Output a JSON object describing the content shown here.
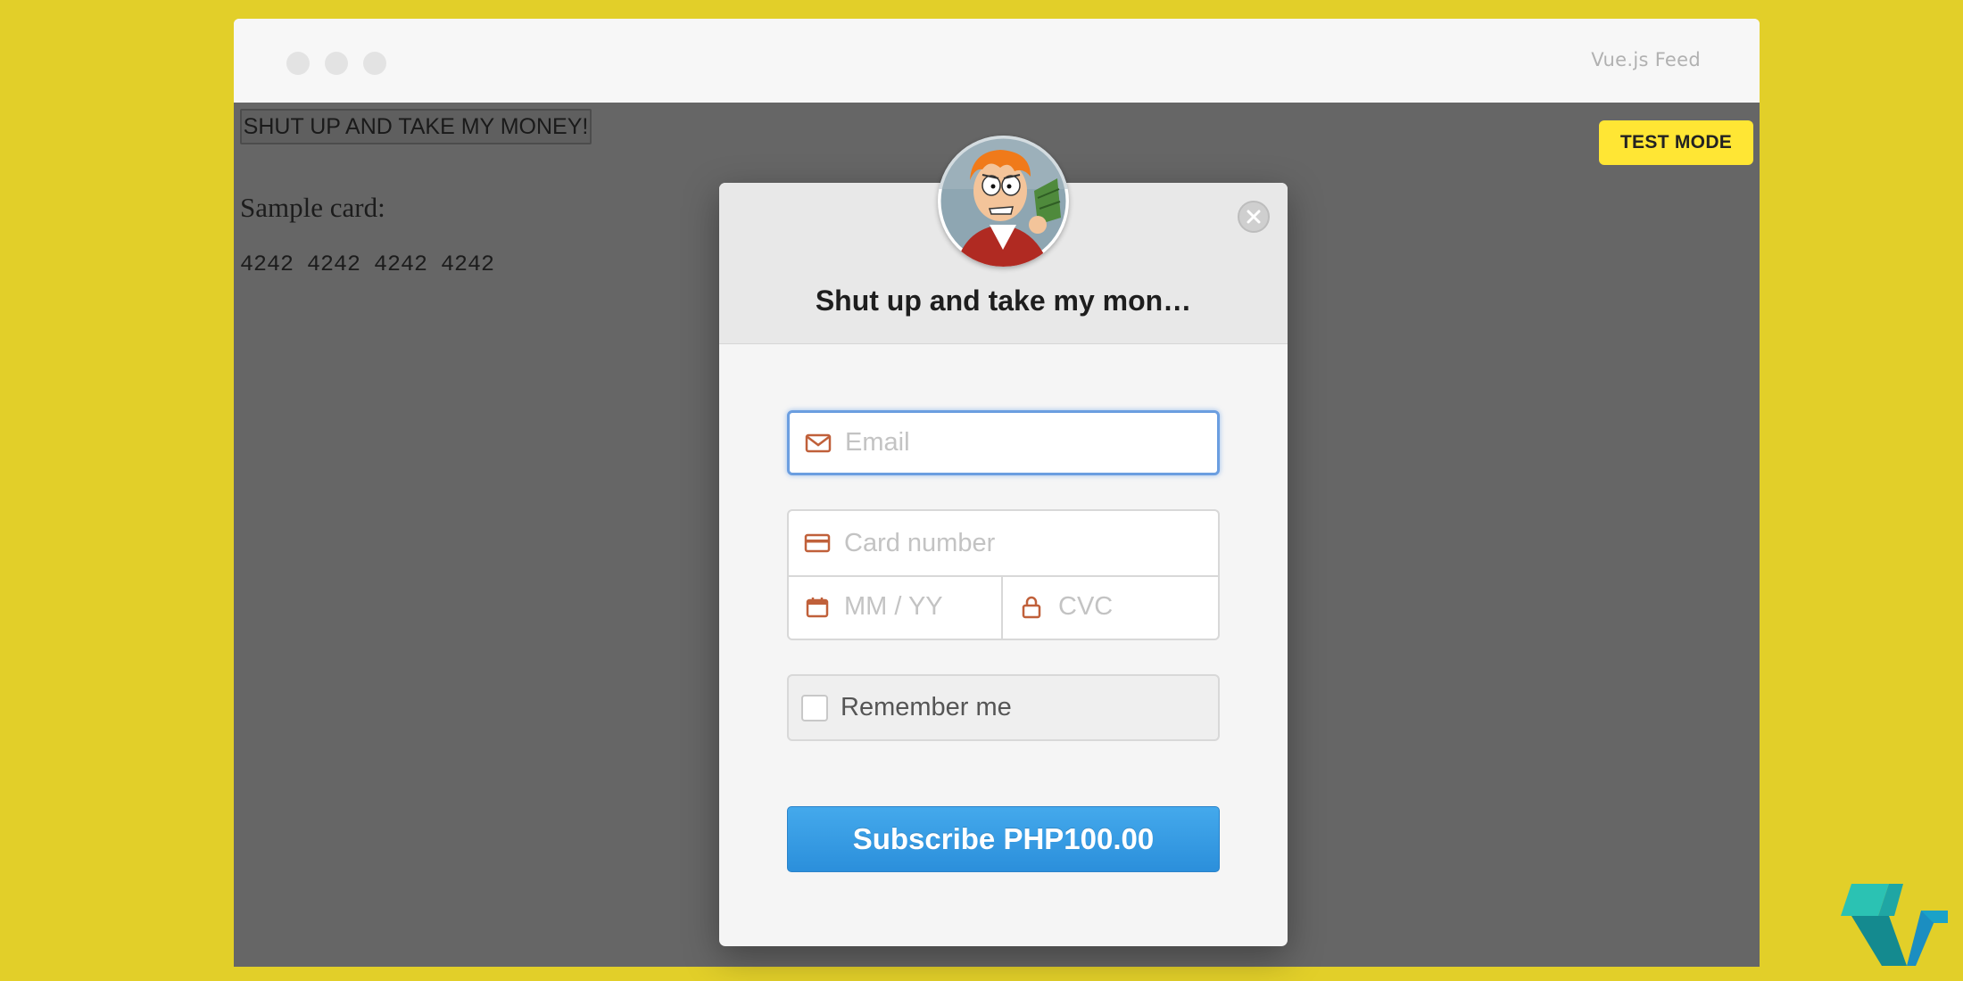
{
  "window": {
    "title": "Vue.js Feed"
  },
  "page": {
    "money_button_label": "SHUT UP AND TAKE MY MONEY!",
    "sample_label": "Sample card:",
    "sample_card_number": "4242 4242 4242 4242",
    "test_mode_badge": "TEST MODE"
  },
  "checkout": {
    "title": "Shut up and take my mon…",
    "email_placeholder": "Email",
    "card_number_placeholder": "Card number",
    "expiry_placeholder": "MM / YY",
    "cvc_placeholder": "CVC",
    "remember_label": "Remember me",
    "subscribe_label": "Subscribe PHP100.00"
  },
  "colors": {
    "background": "#e2cf29",
    "overlay": "#666666",
    "accent": "#2b8fdb",
    "icon": "#c0603a",
    "test_mode": "#ffe634"
  },
  "icons": {
    "email": "envelope-icon",
    "card": "credit-card-icon",
    "expiry": "calendar-icon",
    "cvc": "lock-icon",
    "close": "close-icon"
  }
}
